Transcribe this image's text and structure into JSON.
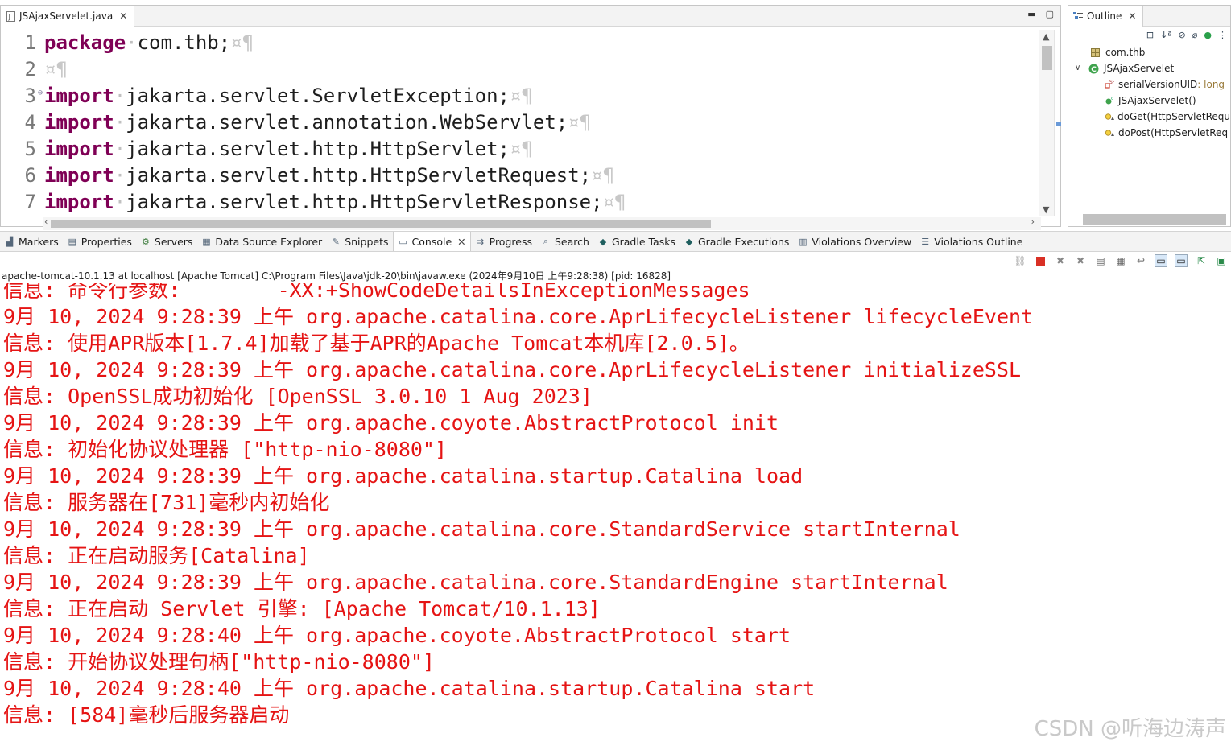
{
  "editor": {
    "tab_title": "JSAjaxServelet.java",
    "lines": [
      {
        "num": "1",
        "kw": "package",
        "rest": "com.thb;",
        "fold": ""
      },
      {
        "num": "2",
        "kw": "",
        "rest": "",
        "fold": ""
      },
      {
        "num": "3",
        "kw": "import",
        "rest": "jakarta.servlet.ServletException;",
        "fold": "⊖"
      },
      {
        "num": "4",
        "kw": "import",
        "rest": "jakarta.servlet.annotation.WebServlet;",
        "fold": ""
      },
      {
        "num": "5",
        "kw": "import",
        "rest": "jakarta.servlet.http.HttpServlet;",
        "fold": ""
      },
      {
        "num": "6",
        "kw": "import",
        "rest": "jakarta.servlet.http.HttpServletRequest;",
        "fold": ""
      },
      {
        "num": "7",
        "kw": "import",
        "rest": "jakarta.servlet.http.HttpServletResponse;",
        "fold": ""
      }
    ],
    "ws_dot": "·",
    "eol_marker": "¤¶"
  },
  "outline": {
    "tab_title": "Outline",
    "package": "com.thb",
    "class": "JSAjaxServelet",
    "members": [
      {
        "name": "serialVersionUID",
        "type": " : long",
        "icon": "field-icon"
      },
      {
        "name": "JSAjaxServelet()",
        "type": "",
        "icon": "constructor-icon"
      },
      {
        "name": "doGet(HttpServletRequ",
        "type": "",
        "icon": "method-icon"
      },
      {
        "name": "doPost(HttpServletReq",
        "type": "",
        "icon": "method-icon"
      }
    ]
  },
  "views": {
    "tabs": [
      {
        "label": "Markers",
        "icon": "markers-icon"
      },
      {
        "label": "Properties",
        "icon": "properties-icon"
      },
      {
        "label": "Servers",
        "icon": "servers-icon"
      },
      {
        "label": "Data Source Explorer",
        "icon": "data-source-icon"
      },
      {
        "label": "Snippets",
        "icon": "snippets-icon"
      },
      {
        "label": "Console",
        "icon": "console-icon",
        "active": true
      },
      {
        "label": "Progress",
        "icon": "progress-icon"
      },
      {
        "label": "Search",
        "icon": "search-icon"
      },
      {
        "label": "Gradle Tasks",
        "icon": "gradle-icon"
      },
      {
        "label": "Gradle Executions",
        "icon": "gradle-icon"
      },
      {
        "label": "Violations Overview",
        "icon": "violations-icon"
      },
      {
        "label": "Violations Outline",
        "icon": "violations-outline-icon"
      }
    ]
  },
  "console": {
    "header": "apache-tomcat-10.1.13 at localhost [Apache Tomcat] C:\\Program Files\\Java\\jdk-20\\bin\\javaw.exe  (2024年9月10日 上午9:28:38) [pid: 16828]",
    "lines": [
      "信息: 命令行参数:        -XX:+ShowCodeDetailsInExceptionMessages",
      "9月 10, 2024 9:28:39 上午 org.apache.catalina.core.AprLifecycleListener lifecycleEvent",
      "信息: 使用APR版本[1.7.4]加载了基于APR的Apache Tomcat本机库[2.0.5]。",
      "9月 10, 2024 9:28:39 上午 org.apache.catalina.core.AprLifecycleListener initializeSSL",
      "信息: OpenSSL成功初始化 [OpenSSL 3.0.10 1 Aug 2023]",
      "9月 10, 2024 9:28:39 上午 org.apache.coyote.AbstractProtocol init",
      "信息: 初始化协议处理器 [\"http-nio-8080\"]",
      "9月 10, 2024 9:28:39 上午 org.apache.catalina.startup.Catalina load",
      "信息: 服务器在[731]毫秒内初始化",
      "9月 10, 2024 9:28:39 上午 org.apache.catalina.core.StandardService startInternal",
      "信息: 正在启动服务[Catalina]",
      "9月 10, 2024 9:28:39 上午 org.apache.catalina.core.StandardEngine startInternal",
      "信息: 正在启动 Servlet 引擎: [Apache Tomcat/10.1.13]",
      "9月 10, 2024 9:28:40 上午 org.apache.coyote.AbstractProtocol start",
      "信息: 开始协议处理句柄[\"http-nio-8080\"]",
      "9月 10, 2024 9:28:40 上午 org.apache.catalina.startup.Catalina start",
      "信息: [584]毫秒后服务器启动"
    ],
    "text_color": "#e51414"
  },
  "watermark": "CSDN @听海边涛声"
}
